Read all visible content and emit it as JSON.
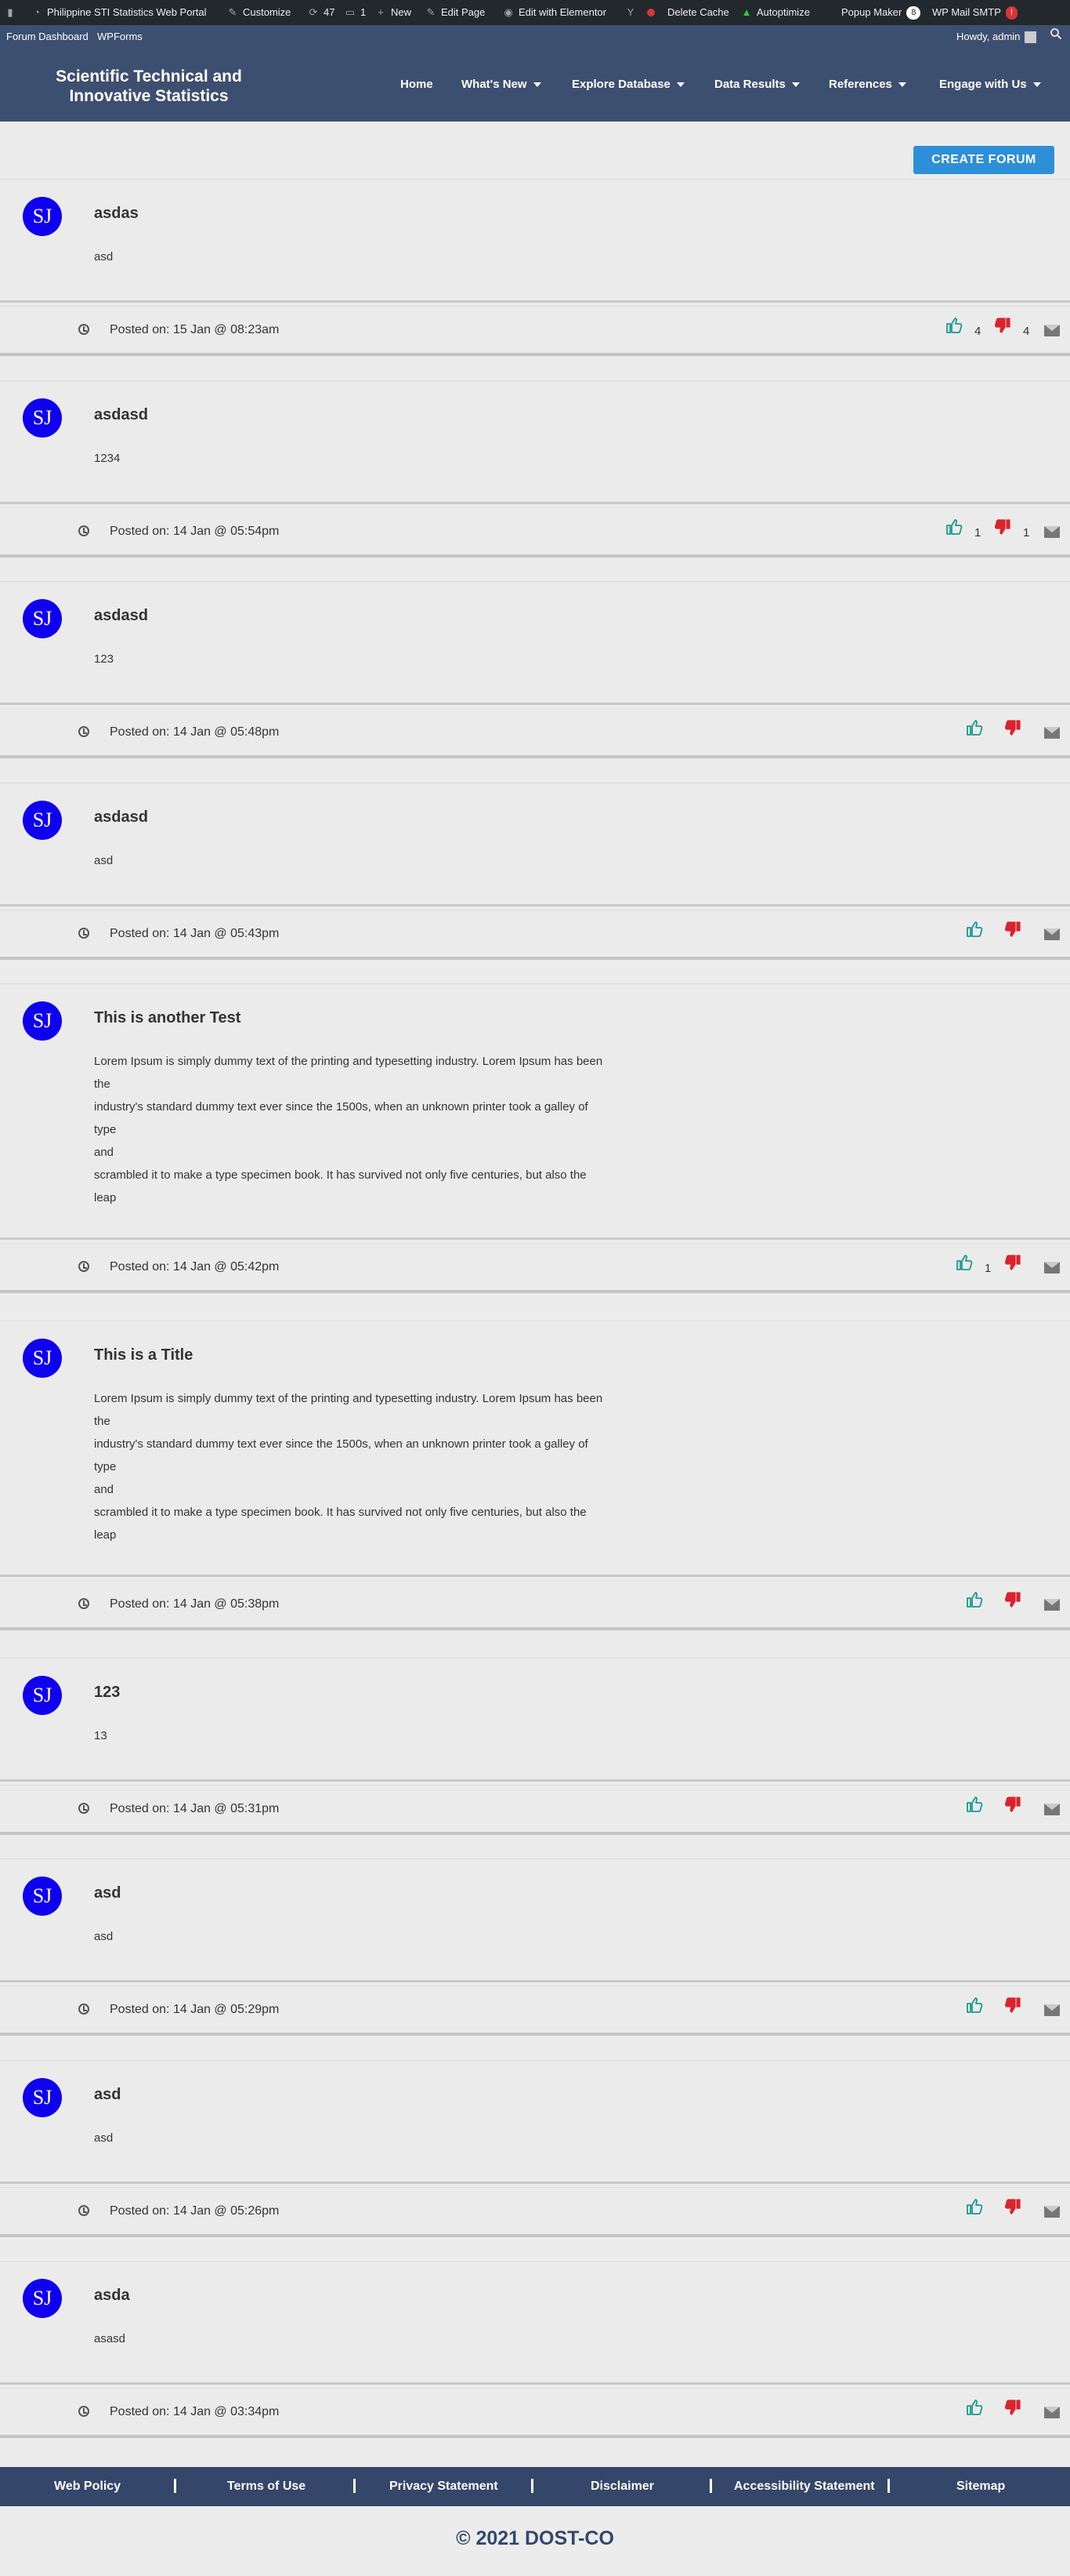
{
  "admin_bar": {
    "site_name": "Philippine STI Statistics Web Portal",
    "customize": "Customize",
    "updates_count": "47",
    "comments_count": "1",
    "new": "New",
    "edit_page": "Edit Page",
    "edit_elementor": "Edit with Elementor",
    "delete_cache": "Delete Cache",
    "autoptimize": "Autoptimize",
    "popup_maker": "Popup Maker",
    "popup_maker_count": "8",
    "wp_mail_smtp": "WP Mail SMTP",
    "wp_mail_smtp_alert": "!",
    "forum_dashboard": "Forum Dashboard",
    "wpforms": "WPForms",
    "howdy": "Howdy, admin"
  },
  "site": {
    "title_line1": "Scientific Technical and",
    "title_line2": "Innovative Statistics"
  },
  "nav": [
    {
      "label": "Home",
      "dropdown": false
    },
    {
      "label": "What's New",
      "dropdown": true
    },
    {
      "label": "Explore Database",
      "dropdown": true
    },
    {
      "label": "Data Results",
      "dropdown": true
    },
    {
      "label": "References",
      "dropdown": true
    },
    {
      "label": "Engage with Us",
      "dropdown": true
    }
  ],
  "create_forum_label": "CREATE FORUM",
  "avatar_initials": "SJ",
  "posts": [
    {
      "title": "asdas",
      "content": [
        "asd"
      ],
      "posted": "Posted on: 15 Jan @ 08:23am",
      "likes": "4",
      "dislikes": "4"
    },
    {
      "title": "asdasd",
      "content": [
        "1234"
      ],
      "posted": "Posted on: 14 Jan @ 05:54pm",
      "likes": "1",
      "dislikes": "1"
    },
    {
      "title": "asdasd",
      "content": [
        "123"
      ],
      "posted": "Posted on: 14 Jan @ 05:48pm",
      "likes": "",
      "dislikes": ""
    },
    {
      "title": "asdasd",
      "content": [
        "asd"
      ],
      "posted": "Posted on: 14 Jan @ 05:43pm",
      "likes": "",
      "dislikes": ""
    },
    {
      "title": "This is another Test",
      "content": [
        "Lorem Ipsum is simply dummy text of the printing and typesetting industry. Lorem Ipsum has been",
        "the",
        "industry's standard dummy text ever since the 1500s, when an unknown printer took a galley of",
        "type",
        "and",
        "scrambled it to make a type specimen book. It has survived not only five centuries, but also the",
        "leap"
      ],
      "posted": "Posted on: 14 Jan @ 05:42pm",
      "likes": "1",
      "dislikes": ""
    },
    {
      "title": "This is a Title",
      "content": [
        "Lorem Ipsum is simply dummy text of the printing and typesetting industry. Lorem Ipsum has been",
        "the",
        "industry's standard dummy text ever since the 1500s, when an unknown printer took a galley of",
        "type",
        "and",
        "scrambled it to make a type specimen book. It has survived not only five centuries, but also the",
        "leap"
      ],
      "posted": "Posted on: 14 Jan @ 05:38pm",
      "likes": "",
      "dislikes": ""
    },
    {
      "title": "123",
      "content": [
        "13"
      ],
      "posted": "Posted on: 14 Jan @ 05:31pm",
      "likes": "",
      "dislikes": ""
    },
    {
      "title": "asd",
      "content": [
        "asd"
      ],
      "posted": "Posted on: 14 Jan @ 05:29pm",
      "likes": "",
      "dislikes": ""
    },
    {
      "title": "asd",
      "content": [
        "asd"
      ],
      "posted": "Posted on: 14 Jan @ 05:26pm",
      "likes": "",
      "dislikes": ""
    },
    {
      "title": "asda",
      "content": [
        "asasd"
      ],
      "posted": "Posted on: 14 Jan @ 03:34pm",
      "likes": "",
      "dislikes": ""
    }
  ],
  "footer": {
    "links": [
      "Web Policy",
      "Terms of Use",
      "Privacy Statement",
      "Disclaimer",
      "Accessibility Statement",
      "Sitemap"
    ],
    "separator": "|",
    "copyright": "© 2021 DOST-CO"
  },
  "colors": {
    "like": "#1a9a8a",
    "dislike": "#d9232d",
    "accent": "#2d8fd8",
    "header": "#3d4f70"
  }
}
